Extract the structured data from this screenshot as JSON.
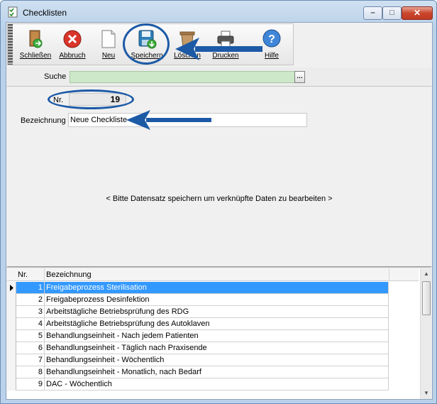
{
  "window": {
    "title": "Checklisten",
    "controls": {
      "minimize": "–",
      "maximize": "□",
      "close": "✕"
    }
  },
  "toolbar": {
    "buttons": [
      {
        "label": "Schließen",
        "icon": "door-exit-icon"
      },
      {
        "label": "Abbruch",
        "icon": "cancel-icon"
      },
      {
        "label": "Neu",
        "icon": "new-document-icon"
      },
      {
        "label": "Speichern",
        "icon": "save-disk-icon"
      },
      {
        "label": "Löschen",
        "icon": "delete-icon"
      },
      {
        "label": "Drucken",
        "icon": "printer-icon"
      },
      {
        "label": "Hilfe",
        "icon": "help-icon"
      }
    ]
  },
  "search": {
    "label": "Suche",
    "value": "",
    "button": "…"
  },
  "form": {
    "nr_label": "Nr.",
    "nr_value": "19",
    "bezeichnung_label": "Bezeichnung",
    "bezeichnung_value": "Neue Checkliste",
    "hint": "< Bitte Datensatz speichern um verknüpfte Daten zu bearbeiten >"
  },
  "grid": {
    "columns": [
      "Nr.",
      "Bezeichnung"
    ],
    "selected_index": 0,
    "rows": [
      {
        "nr": "1",
        "bezeichnung": "Freigabeprozess Sterilisation"
      },
      {
        "nr": "2",
        "bezeichnung": "Freigabeprozess Desinfektion"
      },
      {
        "nr": "3",
        "bezeichnung": "Arbeitstägliche Betriebsprüfung des RDG"
      },
      {
        "nr": "4",
        "bezeichnung": "Arbeitstägliche Betriebsprüfung des Autoklaven"
      },
      {
        "nr": "5",
        "bezeichnung": "Behandlungseinheit - Nach jedem Patienten"
      },
      {
        "nr": "6",
        "bezeichnung": "Behandlungseinheit - Täglich nach Praxisende"
      },
      {
        "nr": "7",
        "bezeichnung": "Behandlungseinheit - Wöchentlich"
      },
      {
        "nr": "8",
        "bezeichnung": "Behandlungseinheit - Monatlich, nach Bedarf"
      },
      {
        "nr": "9",
        "bezeichnung": "DAC - Wöchentlich"
      }
    ]
  },
  "colors": {
    "selection": "#3399ff",
    "search_field": "#cde8c9",
    "annotation": "#1c5aa6"
  }
}
